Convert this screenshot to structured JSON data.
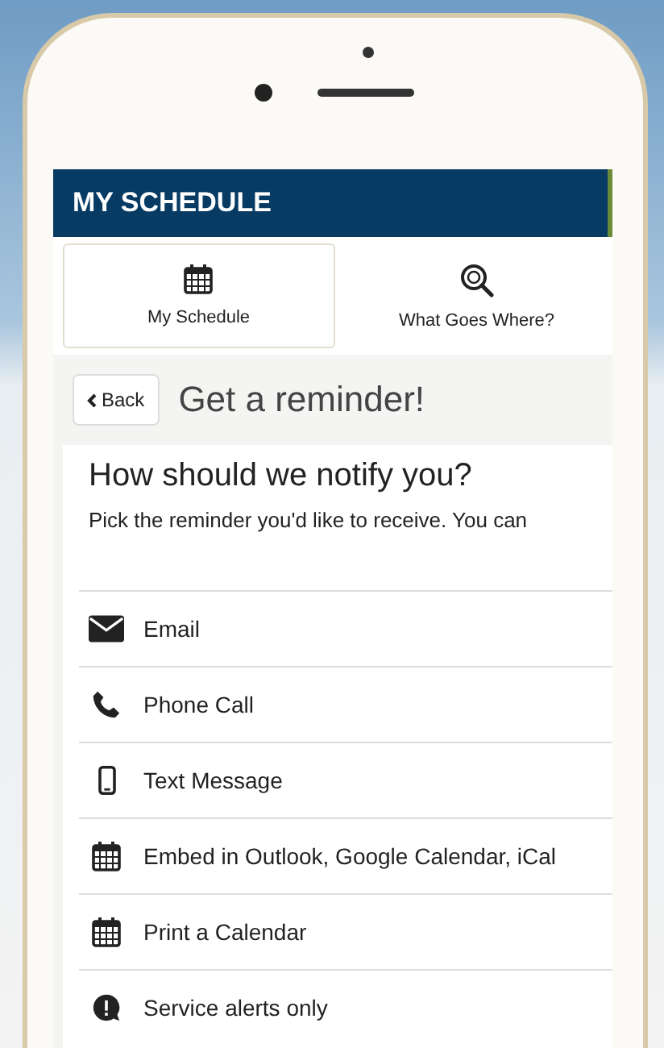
{
  "header": {
    "title": "MY SCHEDULE"
  },
  "tabs": [
    {
      "label": "My Schedule",
      "kind": "calendar",
      "selected": true
    },
    {
      "label": "What Goes Where?",
      "kind": "search",
      "selected": false
    }
  ],
  "back_button": "Back",
  "page_title": "Get a reminder!",
  "question": "How should we notify you?",
  "instructions": "Pick the reminder you'd like to receive. You can",
  "options": [
    {
      "label": "Email",
      "kind": "email"
    },
    {
      "label": "Phone Call",
      "kind": "phone"
    },
    {
      "label": "Text Message",
      "kind": "mobile"
    },
    {
      "label": "Embed in Outlook, Google Calendar, iCal",
      "kind": "calendar"
    },
    {
      "label": "Print a Calendar",
      "kind": "calendar"
    },
    {
      "label": "Service alerts only",
      "kind": "alert"
    }
  ]
}
